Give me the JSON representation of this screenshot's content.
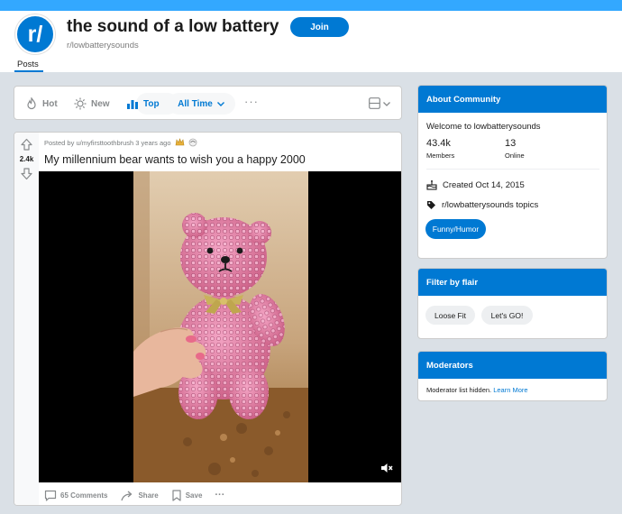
{
  "subreddit": {
    "logo_glyph": "r/",
    "title": "the sound of a low battery",
    "name": "r/lowbatterysounds",
    "join_label": "Join",
    "tab_posts": "Posts"
  },
  "sort": {
    "hot": "Hot",
    "new": "New",
    "top": "Top",
    "time_filter": "All Time",
    "more": "···"
  },
  "post": {
    "votes": "2.4k",
    "meta": "Posted by u/myfirsttoothbrush 3 years ago",
    "title": "My millennium bear wants to wish you a happy 2000",
    "comments": "65 Comments",
    "share": "Share",
    "save": "Save",
    "more": "···"
  },
  "about": {
    "header": "About Community",
    "welcome": "Welcome to lowbatterysounds",
    "members_count": "43.4k",
    "members_label": "Members",
    "online_count": "13",
    "online_label": "Online",
    "created": "Created Oct 14, 2015",
    "topics": "r/lowbatterysounds topics",
    "flair": "Funny/Humor"
  },
  "filter": {
    "header": "Filter by flair",
    "flairs": [
      "Loose Fit",
      "Let's GO!"
    ]
  },
  "moderators": {
    "header": "Moderators",
    "note": "Moderator list hidden.",
    "link": "Learn More"
  },
  "colors": {
    "brand_blue": "#0079d3",
    "banner": "#33a8ff",
    "page_bg": "#dae0e6"
  },
  "icons": [
    "flame-icon",
    "sun-icon",
    "top-chart-icon",
    "chevron-down-icon",
    "card-view-icon",
    "upvote-icon",
    "downvote-icon",
    "award-icon",
    "comment-icon",
    "share-icon",
    "bookmark-icon",
    "mute-icon",
    "cake-icon",
    "tag-icon"
  ]
}
